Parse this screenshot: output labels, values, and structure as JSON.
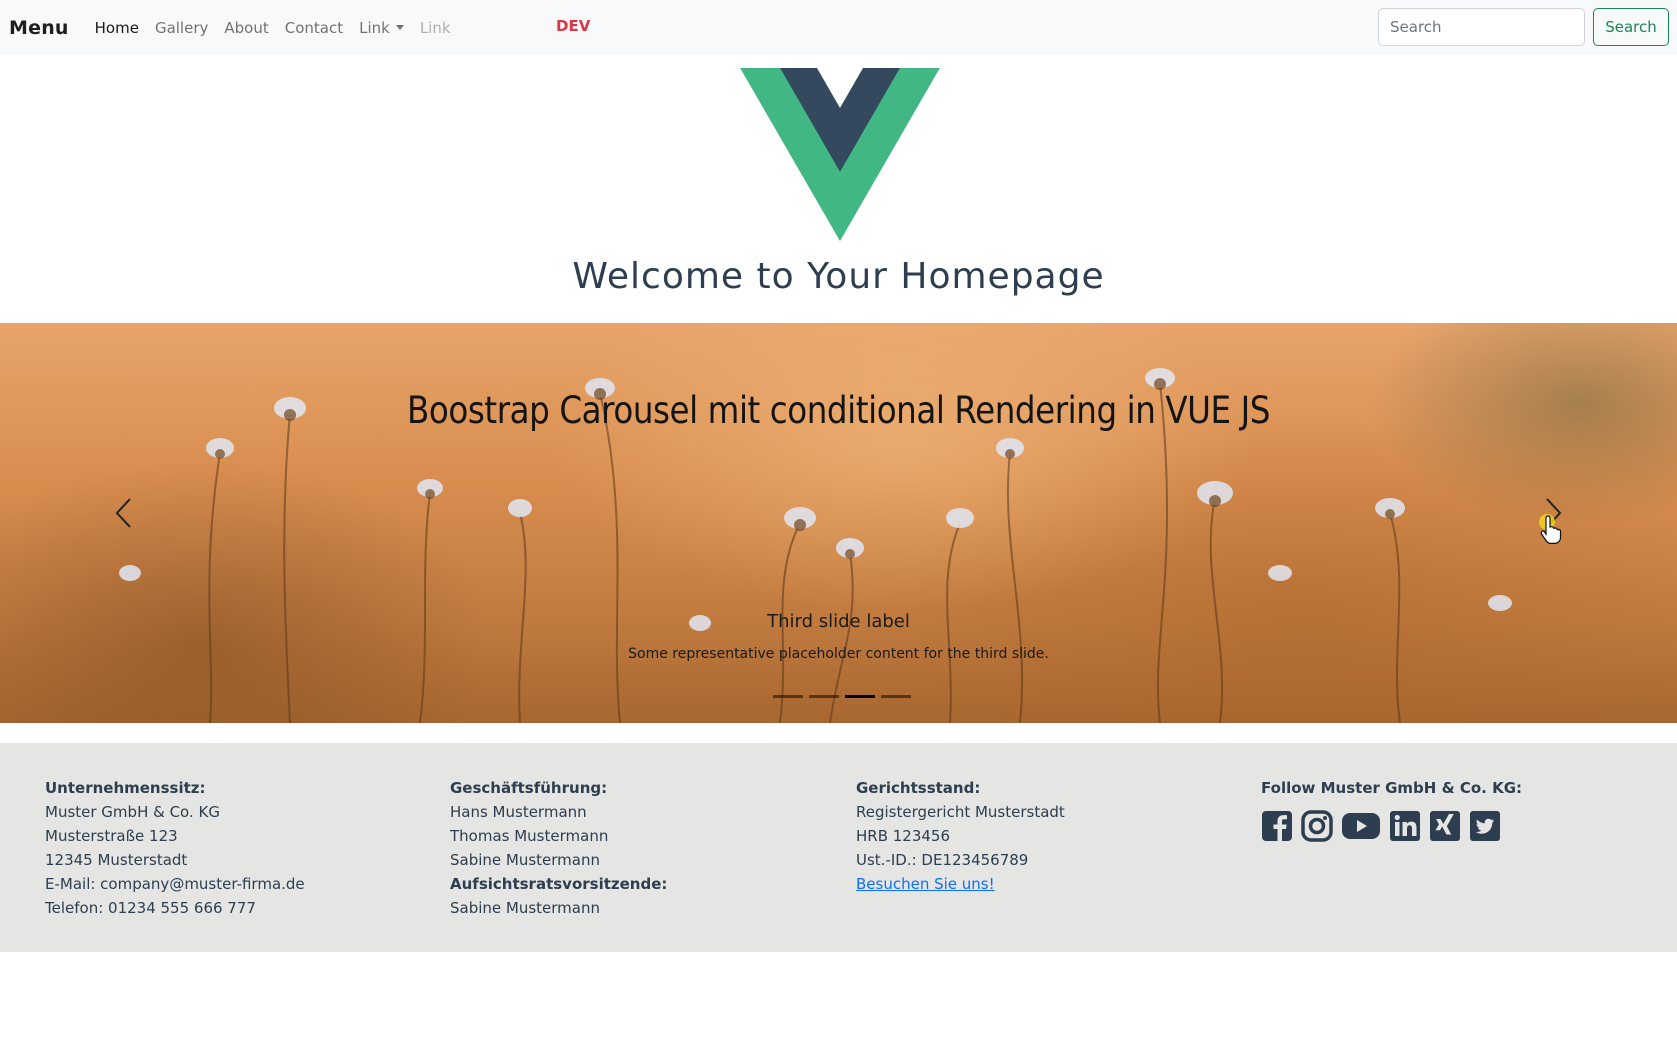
{
  "navbar": {
    "brand": "Menu",
    "links": [
      "Home",
      "Gallery",
      "About",
      "Contact",
      "Link",
      "Link"
    ],
    "env_badge": "DEV",
    "search": {
      "placeholder": "Search",
      "button_label": "Search"
    }
  },
  "hero": {
    "title": "Welcome to Your Homepage"
  },
  "carousel": {
    "heading": "Boostrap Carousel mit conditional Rendering in VUE JS",
    "caption_title": "Third slide label",
    "caption_text": "Some representative placeholder content for the third slide.",
    "indicator_count": 4,
    "active_index": 2
  },
  "footer": {
    "col1": {
      "heading": "Unternehmenssitz:",
      "lines": [
        "Muster GmbH & Co. KG",
        "Musterstraße 123",
        "12345 Musterstadt",
        "E-Mail: company@muster-firma.de",
        "Telefon: 01234 555 666 777"
      ]
    },
    "col2": {
      "heading": "Geschäftsführung:",
      "lines": [
        "Hans Mustermann",
        "Thomas Mustermann",
        "Sabine Mustermann"
      ],
      "heading2": "Aufsichtsratsvorsitzende:",
      "lines2": [
        "Sabine Mustermann"
      ]
    },
    "col3": {
      "heading": "Gerichtsstand:",
      "lines": [
        "Registergericht Musterstadt",
        "HRB 123456",
        "Ust.-ID.: DE123456789"
      ],
      "link": "Besuchen Sie uns!"
    },
    "col4": {
      "heading": "Follow Muster GmbH & Co. KG:",
      "icons": [
        "facebook-icon",
        "instagram-icon",
        "youtube-icon",
        "linkedin-icon",
        "xing-icon",
        "twitter-icon"
      ]
    }
  },
  "colors": {
    "vue_green": "#41b883",
    "vue_dark": "#34495e",
    "success": "#198754",
    "danger": "#dc3545",
    "link": "#0d6efd"
  }
}
